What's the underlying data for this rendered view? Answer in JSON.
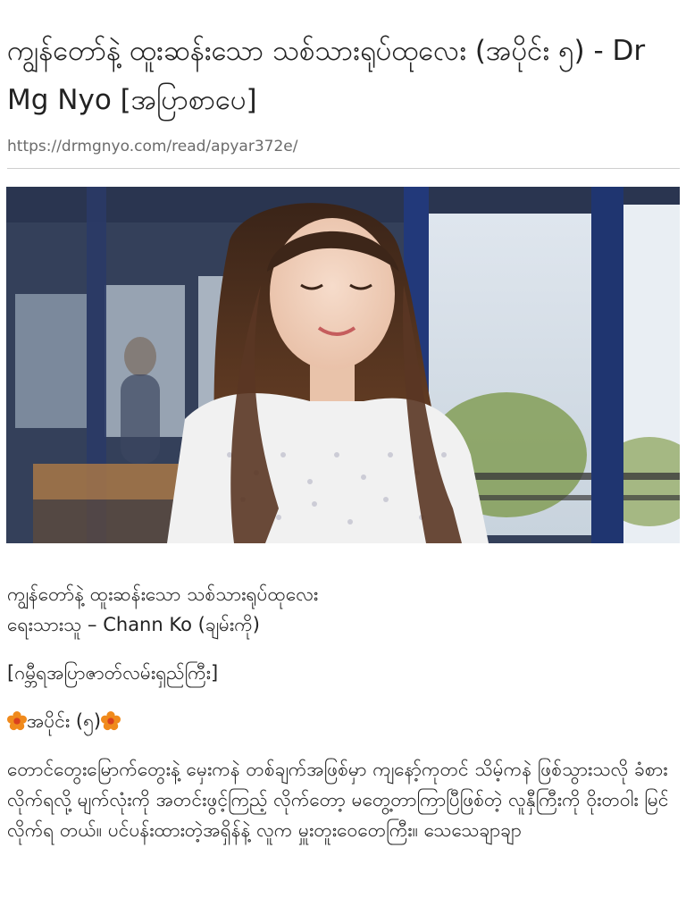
{
  "article": {
    "title": "ကျွန်တော်နဲ့ ထူးဆန်းသော သစ်သားရုပ်ထုလေး (အပိုင်း ၅) - Dr Mg Nyo [အပြာစာပေ]",
    "url": "https://drmgnyo.com/read/apyar372e/",
    "story_title": "ကျွန်တော်နဲ့ ထူးဆန်းသော သစ်သားရုပ်ထုလေး",
    "author_line": "ရေးသားသူ – Chann Ko (ချမ်းကို)",
    "genre_line": "[ဂမ္ဘီရအပြာဇာတ်လမ်းရှည်ကြီး]",
    "part_label": "အပိုင်း (၅)",
    "body": "တောင်တွေးမြောက်တွေးနဲ့ မှေးကနဲ တစ်ချက်အဖြစ်မှာ ကျနော့်ကုတင် သိမ့်ကနဲ ဖြစ်သွားသလို ခံစားလိုက်ရလို့ မျက်လုံးကို အတင်းဖွင့်ကြည့် လိုက်တော့ မတွေ့တာကြာပြီဖြစ်တဲ့ လူနှီကြီးကို ဝိုးတဝါး မြင်လိုက်ရ တယ်။ ပင်ပန်းထားတဲ့အရှိန်နဲ့ လူက မှူးတူးဝေတေကြီး။ သေသေချာချာ"
  },
  "icons": {
    "flower_left": "flower-emoji-icon",
    "flower_right": "flower-emoji-icon"
  },
  "colors": {
    "text": "#222222",
    "url": "#6b6b6b",
    "divider": "#cfcfcf",
    "flower": "#f08a1c"
  }
}
